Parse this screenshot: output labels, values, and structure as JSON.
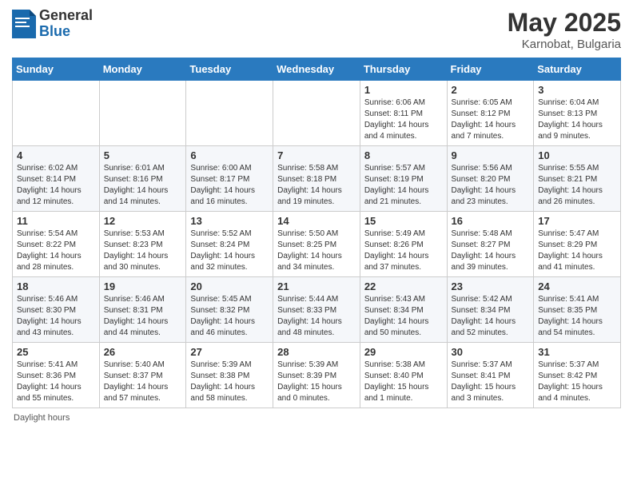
{
  "header": {
    "logo_general": "General",
    "logo_blue": "Blue",
    "title": "May 2025",
    "location": "Karnobat, Bulgaria"
  },
  "days_of_week": [
    "Sunday",
    "Monday",
    "Tuesday",
    "Wednesday",
    "Thursday",
    "Friday",
    "Saturday"
  ],
  "footer": {
    "note": "Daylight hours"
  },
  "weeks": [
    [
      {
        "day": "",
        "info": ""
      },
      {
        "day": "",
        "info": ""
      },
      {
        "day": "",
        "info": ""
      },
      {
        "day": "",
        "info": ""
      },
      {
        "day": "1",
        "info": "Sunrise: 6:06 AM\nSunset: 8:11 PM\nDaylight: 14 hours\nand 4 minutes."
      },
      {
        "day": "2",
        "info": "Sunrise: 6:05 AM\nSunset: 8:12 PM\nDaylight: 14 hours\nand 7 minutes."
      },
      {
        "day": "3",
        "info": "Sunrise: 6:04 AM\nSunset: 8:13 PM\nDaylight: 14 hours\nand 9 minutes."
      }
    ],
    [
      {
        "day": "4",
        "info": "Sunrise: 6:02 AM\nSunset: 8:14 PM\nDaylight: 14 hours\nand 12 minutes."
      },
      {
        "day": "5",
        "info": "Sunrise: 6:01 AM\nSunset: 8:16 PM\nDaylight: 14 hours\nand 14 minutes."
      },
      {
        "day": "6",
        "info": "Sunrise: 6:00 AM\nSunset: 8:17 PM\nDaylight: 14 hours\nand 16 minutes."
      },
      {
        "day": "7",
        "info": "Sunrise: 5:58 AM\nSunset: 8:18 PM\nDaylight: 14 hours\nand 19 minutes."
      },
      {
        "day": "8",
        "info": "Sunrise: 5:57 AM\nSunset: 8:19 PM\nDaylight: 14 hours\nand 21 minutes."
      },
      {
        "day": "9",
        "info": "Sunrise: 5:56 AM\nSunset: 8:20 PM\nDaylight: 14 hours\nand 23 minutes."
      },
      {
        "day": "10",
        "info": "Sunrise: 5:55 AM\nSunset: 8:21 PM\nDaylight: 14 hours\nand 26 minutes."
      }
    ],
    [
      {
        "day": "11",
        "info": "Sunrise: 5:54 AM\nSunset: 8:22 PM\nDaylight: 14 hours\nand 28 minutes."
      },
      {
        "day": "12",
        "info": "Sunrise: 5:53 AM\nSunset: 8:23 PM\nDaylight: 14 hours\nand 30 minutes."
      },
      {
        "day": "13",
        "info": "Sunrise: 5:52 AM\nSunset: 8:24 PM\nDaylight: 14 hours\nand 32 minutes."
      },
      {
        "day": "14",
        "info": "Sunrise: 5:50 AM\nSunset: 8:25 PM\nDaylight: 14 hours\nand 34 minutes."
      },
      {
        "day": "15",
        "info": "Sunrise: 5:49 AM\nSunset: 8:26 PM\nDaylight: 14 hours\nand 37 minutes."
      },
      {
        "day": "16",
        "info": "Sunrise: 5:48 AM\nSunset: 8:27 PM\nDaylight: 14 hours\nand 39 minutes."
      },
      {
        "day": "17",
        "info": "Sunrise: 5:47 AM\nSunset: 8:29 PM\nDaylight: 14 hours\nand 41 minutes."
      }
    ],
    [
      {
        "day": "18",
        "info": "Sunrise: 5:46 AM\nSunset: 8:30 PM\nDaylight: 14 hours\nand 43 minutes."
      },
      {
        "day": "19",
        "info": "Sunrise: 5:46 AM\nSunset: 8:31 PM\nDaylight: 14 hours\nand 44 minutes."
      },
      {
        "day": "20",
        "info": "Sunrise: 5:45 AM\nSunset: 8:32 PM\nDaylight: 14 hours\nand 46 minutes."
      },
      {
        "day": "21",
        "info": "Sunrise: 5:44 AM\nSunset: 8:33 PM\nDaylight: 14 hours\nand 48 minutes."
      },
      {
        "day": "22",
        "info": "Sunrise: 5:43 AM\nSunset: 8:34 PM\nDaylight: 14 hours\nand 50 minutes."
      },
      {
        "day": "23",
        "info": "Sunrise: 5:42 AM\nSunset: 8:34 PM\nDaylight: 14 hours\nand 52 minutes."
      },
      {
        "day": "24",
        "info": "Sunrise: 5:41 AM\nSunset: 8:35 PM\nDaylight: 14 hours\nand 54 minutes."
      }
    ],
    [
      {
        "day": "25",
        "info": "Sunrise: 5:41 AM\nSunset: 8:36 PM\nDaylight: 14 hours\nand 55 minutes."
      },
      {
        "day": "26",
        "info": "Sunrise: 5:40 AM\nSunset: 8:37 PM\nDaylight: 14 hours\nand 57 minutes."
      },
      {
        "day": "27",
        "info": "Sunrise: 5:39 AM\nSunset: 8:38 PM\nDaylight: 14 hours\nand 58 minutes."
      },
      {
        "day": "28",
        "info": "Sunrise: 5:39 AM\nSunset: 8:39 PM\nDaylight: 15 hours\nand 0 minutes."
      },
      {
        "day": "29",
        "info": "Sunrise: 5:38 AM\nSunset: 8:40 PM\nDaylight: 15 hours\nand 1 minute."
      },
      {
        "day": "30",
        "info": "Sunrise: 5:37 AM\nSunset: 8:41 PM\nDaylight: 15 hours\nand 3 minutes."
      },
      {
        "day": "31",
        "info": "Sunrise: 5:37 AM\nSunset: 8:42 PM\nDaylight: 15 hours\nand 4 minutes."
      }
    ]
  ]
}
